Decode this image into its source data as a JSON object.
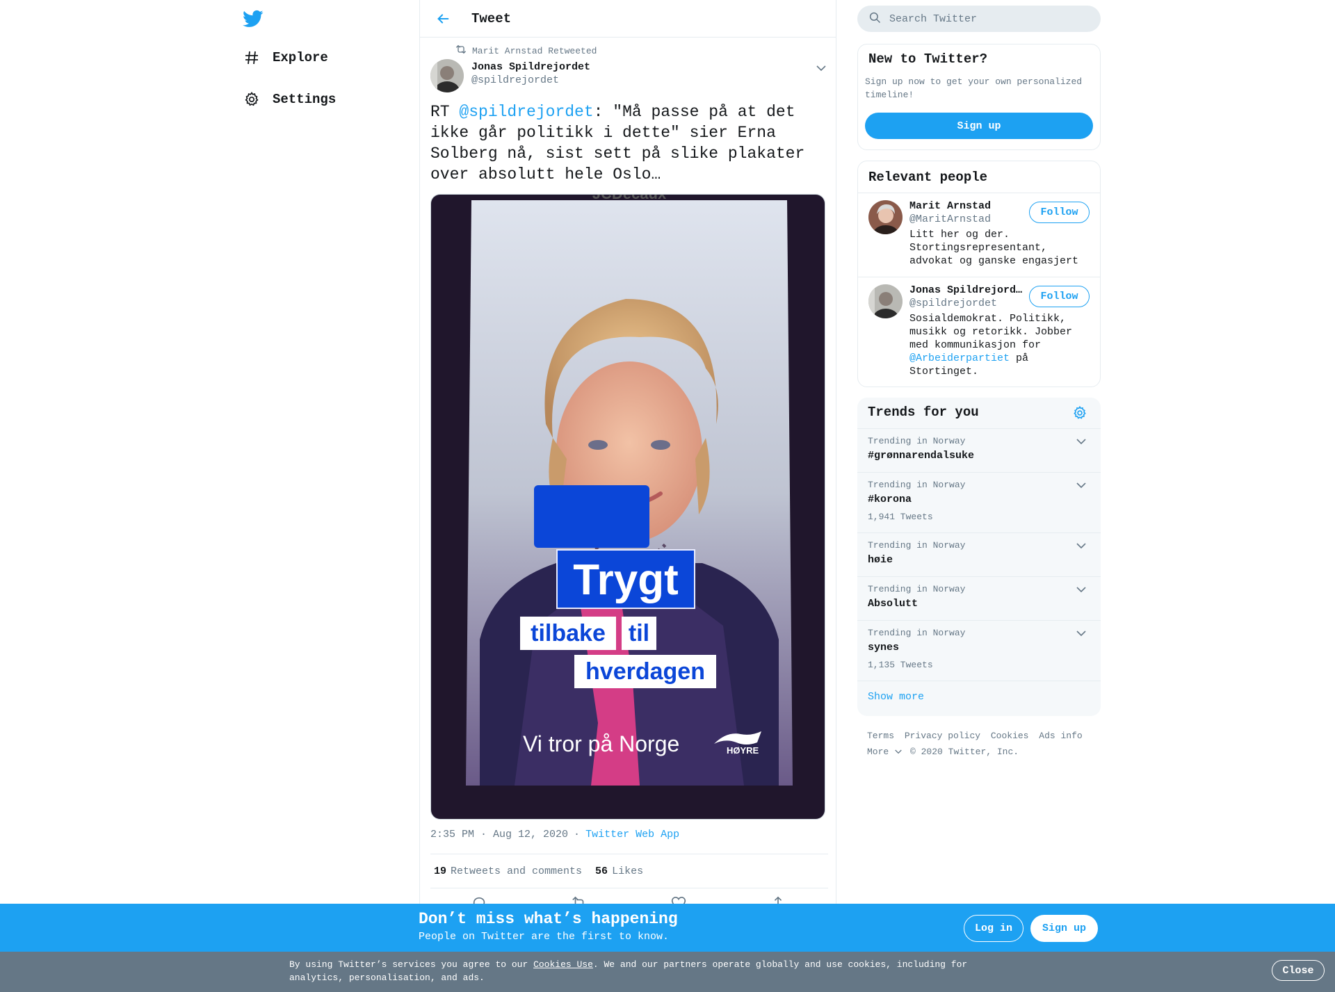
{
  "colors": {
    "accent": "#1da1f2",
    "muted": "#657786",
    "cookie_bar": "#657786",
    "poster_blue": "#0b46d8"
  },
  "nav": {
    "logo_icon": "twitter-bird-icon",
    "items": [
      {
        "label": "Explore",
        "icon": "hashtag-icon"
      },
      {
        "label": "Settings",
        "icon": "gear-icon"
      }
    ]
  },
  "header": {
    "title": "Tweet"
  },
  "tweet": {
    "retweet_context": "Marit Arnstad Retweeted",
    "author_name": "Jonas Spildrejordet",
    "author_handle": "@spildrejordet",
    "text_prefix": "RT ",
    "mention": "@spildrejordet",
    "text_body": ": \"Må passe på at det ikke går politikk i dette\" sier Erna Solberg nå, sist sett på slike plakater over absolutt hele Oslo…",
    "image": {
      "top_text": "JCDecaux",
      "line1": "Trygt",
      "line2a": "tilbake",
      "line2b": "til",
      "line3": "hverdagen",
      "slogan": "Vi tror på Norge",
      "party": "HØYRE"
    },
    "timestamp": "2:35 PM · Aug 12, 2020",
    "separator": "·",
    "source": "Twitter Web App",
    "retweets_count": "19",
    "retweets_label": "Retweets and comments",
    "likes_count": "56",
    "likes_label": "Likes"
  },
  "search": {
    "placeholder": "Search Twitter"
  },
  "new_to_twitter": {
    "title": "New to Twitter?",
    "text": "Sign up now to get your own personalized timeline!",
    "button": "Sign up"
  },
  "relevant_people": {
    "title": "Relevant people",
    "people": [
      {
        "name": "Marit Arnstad",
        "handle": "@MaritArnstad",
        "bio": "Litt her og der. Stortingsrepresentant, advokat og ganske engasjert",
        "button": "Follow"
      },
      {
        "name": "Jonas Spildrejord…",
        "handle": "@spildrejordet",
        "bio_pre": "Sosialdemokrat. Politikk, musikk og retorikk. Jobber med kommunikasjon for ",
        "bio_link": "@Arbeiderpartiet",
        "bio_post": " på Stortinget.",
        "button": "Follow"
      }
    ]
  },
  "trends": {
    "title": "Trends for you",
    "items": [
      {
        "context": "Trending in Norway",
        "name": "#grønnarendalsuke",
        "count": ""
      },
      {
        "context": "Trending in Norway",
        "name": "#korona",
        "count": "1,941 Tweets"
      },
      {
        "context": "Trending in Norway",
        "name": "høie",
        "count": ""
      },
      {
        "context": "Trending in Norway",
        "name": "Absolutt",
        "count": ""
      },
      {
        "context": "Trending in Norway",
        "name": "synes",
        "count": "1,135 Tweets"
      }
    ],
    "show_more": "Show more"
  },
  "footer": {
    "links": [
      "Terms",
      "Privacy policy",
      "Cookies",
      "Ads info",
      "More"
    ],
    "copyright": "© 2020 Twitter, Inc."
  },
  "cta": {
    "title": "Don’t miss what’s happening",
    "subtitle": "People on Twitter are the first to know.",
    "login": "Log in",
    "signup": "Sign up"
  },
  "cookie": {
    "text_pre": "By using Twitter’s services you agree to our ",
    "link": "Cookies Use",
    "text_post": ". We and our partners operate globally and use cookies, including for analytics, personalisation, and ads.",
    "close": "Close"
  }
}
